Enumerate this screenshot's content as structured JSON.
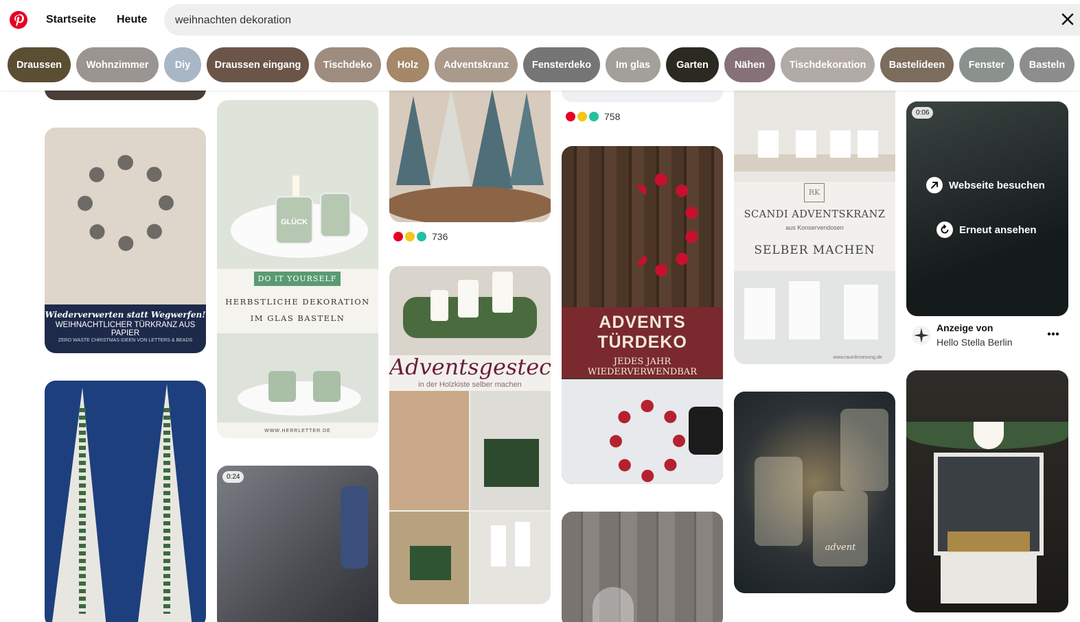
{
  "header": {
    "logo": "pinterest-logo",
    "nav": {
      "home": "Startseite",
      "today": "Heute"
    },
    "search": {
      "value": "weihnachten dekoration",
      "clear_icon": "close-icon"
    }
  },
  "chips": [
    {
      "label": "Draussen",
      "color": "#5a4f33"
    },
    {
      "label": "Wohnzimmer",
      "color": "#9a9590"
    },
    {
      "label": "Diy",
      "color": "#a9b6c6"
    },
    {
      "label": "Draussen eingang",
      "color": "#6b5548"
    },
    {
      "label": "Tischdeko",
      "color": "#9e8d7e"
    },
    {
      "label": "Holz",
      "color": "#a48867"
    },
    {
      "label": "Adventskranz",
      "color": "#aa9a8c"
    },
    {
      "label": "Fensterdeko",
      "color": "#757575"
    },
    {
      "label": "Im glas",
      "color": "#a3a09b"
    },
    {
      "label": "Garten",
      "color": "#2b2a20"
    },
    {
      "label": "Nähen",
      "color": "#857177"
    },
    {
      "label": "Tischdekoration",
      "color": "#b1aaa6"
    },
    {
      "label": "Bastelideen",
      "color": "#7c6c5b"
    },
    {
      "label": "Fenster",
      "color": "#8a928e"
    },
    {
      "label": "Basteln",
      "color": "#8d8d8d"
    }
  ],
  "pins": {
    "wreath_paper": {
      "line1": "Wiederverwerten statt Wegwerfen!",
      "line2": "WEIHNACHTLICHER TÜRKRANZ AUS PAPIER",
      "line3": "ZERO WASTE CHRISTMAS IDEEN VON LETTERS & BEADS"
    },
    "glass_candles": {
      "badge": "DO IT YOURSELF",
      "title1": "HERBSTLICHE DEKORATION",
      "title2": "IM GLAS BASTELN",
      "jar_label": "GLÜCK",
      "source": "WWW.HERRLETTER.DE"
    },
    "video1": {
      "duration": "0:24"
    },
    "trees_count": "736",
    "adventsgesteck": {
      "title": "Adventsgesteck",
      "subtitle": "in der Holzkiste selber machen"
    },
    "top_count": "758",
    "advents_turdeko": {
      "title1": "ADVENTS",
      "title2": "TÜRDEKO",
      "subtitle": "JEDES JAHR WIEDERVERWENDBAR"
    },
    "scandi": {
      "logo": "RK",
      "title": "SCANDI ADVENTSKRANZ",
      "subtitle": "aus Konservendosen",
      "title2": "SELBER MACHEN",
      "source": "www.raumkroenung.de"
    },
    "jars_label": "advent",
    "ad": {
      "duration": "0:06",
      "visit_label": "Webseite besuchen",
      "replay_label": "Erneut ansehen",
      "ad_by": "Anzeige von",
      "advertiser": "Hello Stella Berlin"
    }
  }
}
